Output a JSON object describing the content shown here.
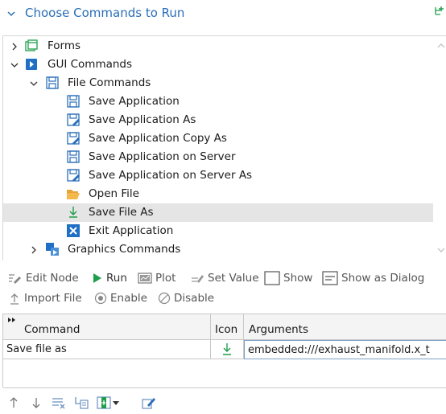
{
  "section": {
    "title": "Choose Commands to Run",
    "collapse_icon": "chevron-down-icon",
    "corner_icon": "tree-add-icon"
  },
  "tree": {
    "items": [
      {
        "label": "Forms",
        "level": 0,
        "expanded": false,
        "icon": "forms-icon"
      },
      {
        "label": "GUI Commands",
        "level": 0,
        "expanded": true,
        "icon": "gui-commands-icon"
      },
      {
        "label": "File Commands",
        "level": 1,
        "expanded": true,
        "icon": "floppy-icon"
      },
      {
        "label": "Save Application",
        "level": 2,
        "icon": "floppy-icon"
      },
      {
        "label": "Save Application As",
        "level": 2,
        "icon": "floppy-pen-icon"
      },
      {
        "label": "Save Application Copy As",
        "level": 2,
        "icon": "floppy-pen-icon"
      },
      {
        "label": "Save Application on Server",
        "level": 2,
        "icon": "floppy-icon"
      },
      {
        "label": "Save Application on Server As",
        "level": 2,
        "icon": "floppy-pen-icon"
      },
      {
        "label": "Open File",
        "level": 2,
        "icon": "open-folder-icon"
      },
      {
        "label": "Save File As",
        "level": 2,
        "icon": "download-arrow-icon",
        "selected": true
      },
      {
        "label": "Exit Application",
        "level": 2,
        "icon": "close-box-icon"
      },
      {
        "label": "Graphics Commands",
        "level": 1,
        "expanded": false,
        "icon": "graphics-icon"
      }
    ]
  },
  "toolbar1": {
    "edit_node": "Edit Node",
    "run": "Run",
    "plot": "Plot",
    "set_value": "Set Value",
    "show": "Show",
    "show_as_dialog": "Show as Dialog"
  },
  "toolbar2": {
    "import_file": "Import File",
    "enable": "Enable",
    "disable": "Disable"
  },
  "table": {
    "headers": {
      "command": "Command",
      "icon": "Icon",
      "arguments": "Arguments"
    },
    "rows": [
      {
        "command": "Save file as",
        "icon": "download-arrow-icon",
        "arguments": "embedded:///exhaust_manifold.x_t"
      }
    ]
  },
  "bottom_toolbar": {
    "icons": [
      "move-up-icon",
      "move-down-icon",
      "delete-list-icon",
      "insert-below-icon",
      "add-column-icon",
      "edit-icon"
    ]
  },
  "colors": {
    "accent": "#2a6fb8",
    "green": "#1e9e4a",
    "selected_row": "#e5e5e5"
  }
}
